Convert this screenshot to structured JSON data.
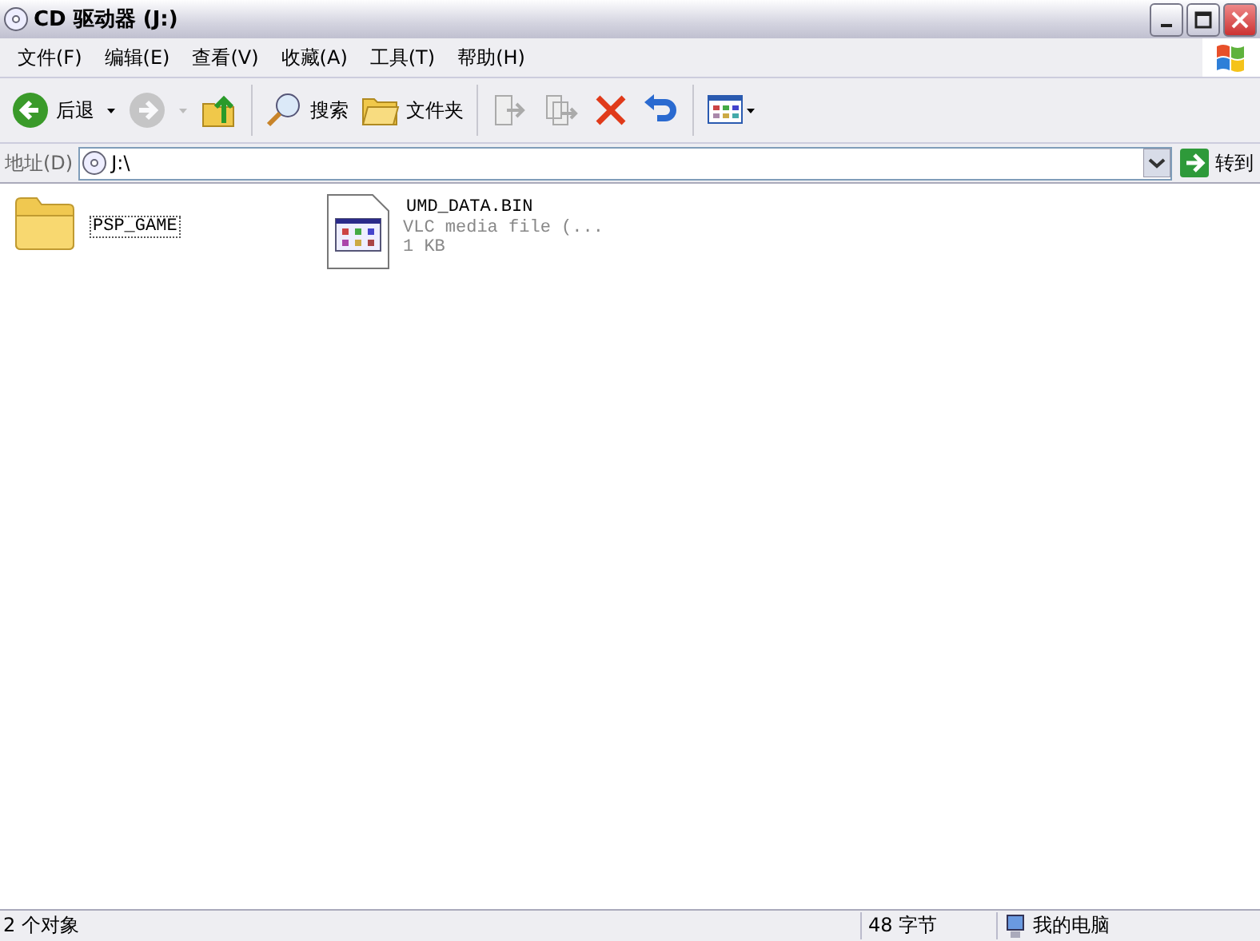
{
  "window": {
    "title": "CD 驱动器 (J:)"
  },
  "menu": [
    "文件(F)",
    "编辑(E)",
    "查看(V)",
    "收藏(A)",
    "工具(T)",
    "帮助(H)"
  ],
  "toolbar": {
    "back": {
      "label": "后退",
      "disabled": false
    },
    "forward": {
      "disabled": true
    },
    "search": "搜索",
    "folders": "文件夹"
  },
  "address": {
    "label": "地址(D)",
    "value": "J:\\",
    "go": "转到"
  },
  "files": [
    {
      "kind": "folder",
      "name": "PSP_GAME",
      "focused": true
    },
    {
      "kind": "file",
      "name": "UMD_DATA.BIN",
      "type": "VLC media file (...",
      "size": "1 KB",
      "focused": false
    }
  ],
  "status_bar": {
    "objects": "2 个对象",
    "size": "48 字节",
    "zone": "我的电脑"
  }
}
